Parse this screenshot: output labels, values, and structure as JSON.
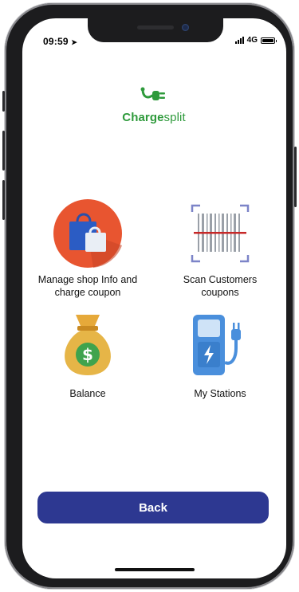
{
  "status_bar": {
    "time": "09:59",
    "network": "4G"
  },
  "app": {
    "logo_part1": "Charge",
    "logo_part2": "split",
    "brand_color": "#2e9a3b"
  },
  "menu": {
    "shop_label_line1": "Manage shop Info and",
    "shop_label_line2": "charge coupon",
    "scan_label_line1": "Scan Customers",
    "scan_label_line2": "coupons",
    "balance_label": "Balance",
    "stations_label": "My Stations"
  },
  "actions": {
    "back_label": "Back",
    "button_color": "#2d3891"
  },
  "icons": {
    "shop": "shopping-bags-icon",
    "scan": "barcode-scanner-icon",
    "balance": "money-bag-icon",
    "stations": "charging-station-icon",
    "logo": "plug-icon"
  }
}
